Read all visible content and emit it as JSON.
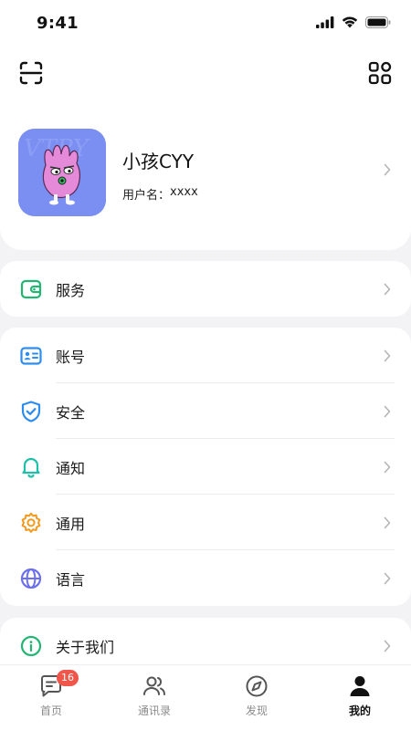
{
  "status_bar": {
    "time": "9:41"
  },
  "profile": {
    "nickname": "小孩CYY",
    "username_label": "用户名：",
    "username_value": "xxxx"
  },
  "menu": {
    "service": {
      "label": "服务",
      "icon": "wallet-icon",
      "color": "#22b573"
    },
    "account": {
      "label": "账号",
      "icon": "id-card-icon",
      "color": "#2d8cf0"
    },
    "security": {
      "label": "安全",
      "icon": "shield-icon",
      "color": "#2d8cf0"
    },
    "notification": {
      "label": "通知",
      "icon": "bell-icon",
      "color": "#1fbfa8"
    },
    "general": {
      "label": "通用",
      "icon": "gear-icon",
      "color": "#f29a1e"
    },
    "language": {
      "label": "语言",
      "icon": "globe-icon",
      "color": "#6b6ff0"
    },
    "about": {
      "label": "关于我们",
      "icon": "info-icon",
      "color": "#22b573"
    }
  },
  "tabbar": {
    "home": {
      "label": "首页",
      "badge": "16",
      "icon": "chat-icon"
    },
    "contacts": {
      "label": "通讯录",
      "icon": "contacts-icon"
    },
    "discover": {
      "label": "发现",
      "icon": "compass-icon"
    },
    "mine": {
      "label": "我的",
      "icon": "person-icon",
      "active": true
    }
  }
}
